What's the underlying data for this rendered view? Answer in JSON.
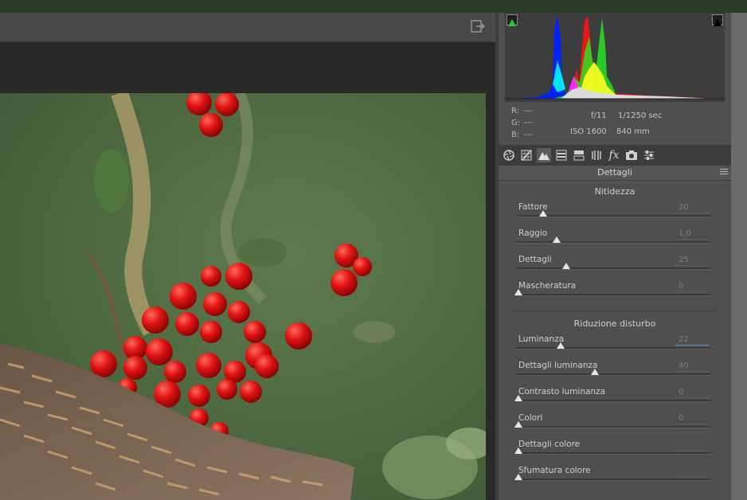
{
  "histogram": {
    "readout": {
      "r_label": "R:",
      "r_value": "---",
      "g_label": "G:",
      "g_value": "---",
      "b_label": "B:",
      "b_value": "---"
    },
    "aperture": "f/11",
    "shutter": "1/1250 sec",
    "iso": "ISO 1600",
    "focal": "840 mm",
    "shadow_clip_color": "#1fd11f"
  },
  "tabs": [
    "basic",
    "tone-curve",
    "detail",
    "hsl",
    "split-toning",
    "lens-corrections",
    "effects",
    "camera-calibration",
    "presets"
  ],
  "panel": {
    "title": "Dettagli",
    "sharpening": {
      "title": "Nitidezza",
      "sliders": [
        {
          "label": "Fattore",
          "value": "20",
          "level": 0.13
        },
        {
          "label": "Raggio",
          "value": "1,0",
          "level": 0.2
        },
        {
          "label": "Dettagli",
          "value": "25",
          "level": 0.25
        },
        {
          "label": "Mascheratura",
          "value": "0",
          "level": 0.0
        }
      ]
    },
    "noise": {
      "title": "Riduzione disturbo",
      "sliders": [
        {
          "label": "Luminanza",
          "value": "22",
          "level": 0.22
        },
        {
          "label": "Dettagli luminanza",
          "value": "40",
          "level": 0.4
        },
        {
          "label": "Contrasto luminanza",
          "value": "0",
          "level": 0.0
        },
        {
          "label": "Colori",
          "value": "0",
          "level": 0.0
        },
        {
          "label": "Dettagli colore",
          "value": "",
          "level": 0.0
        },
        {
          "label": "Sfumatura colore",
          "value": "",
          "level": 0.0
        }
      ]
    }
  }
}
